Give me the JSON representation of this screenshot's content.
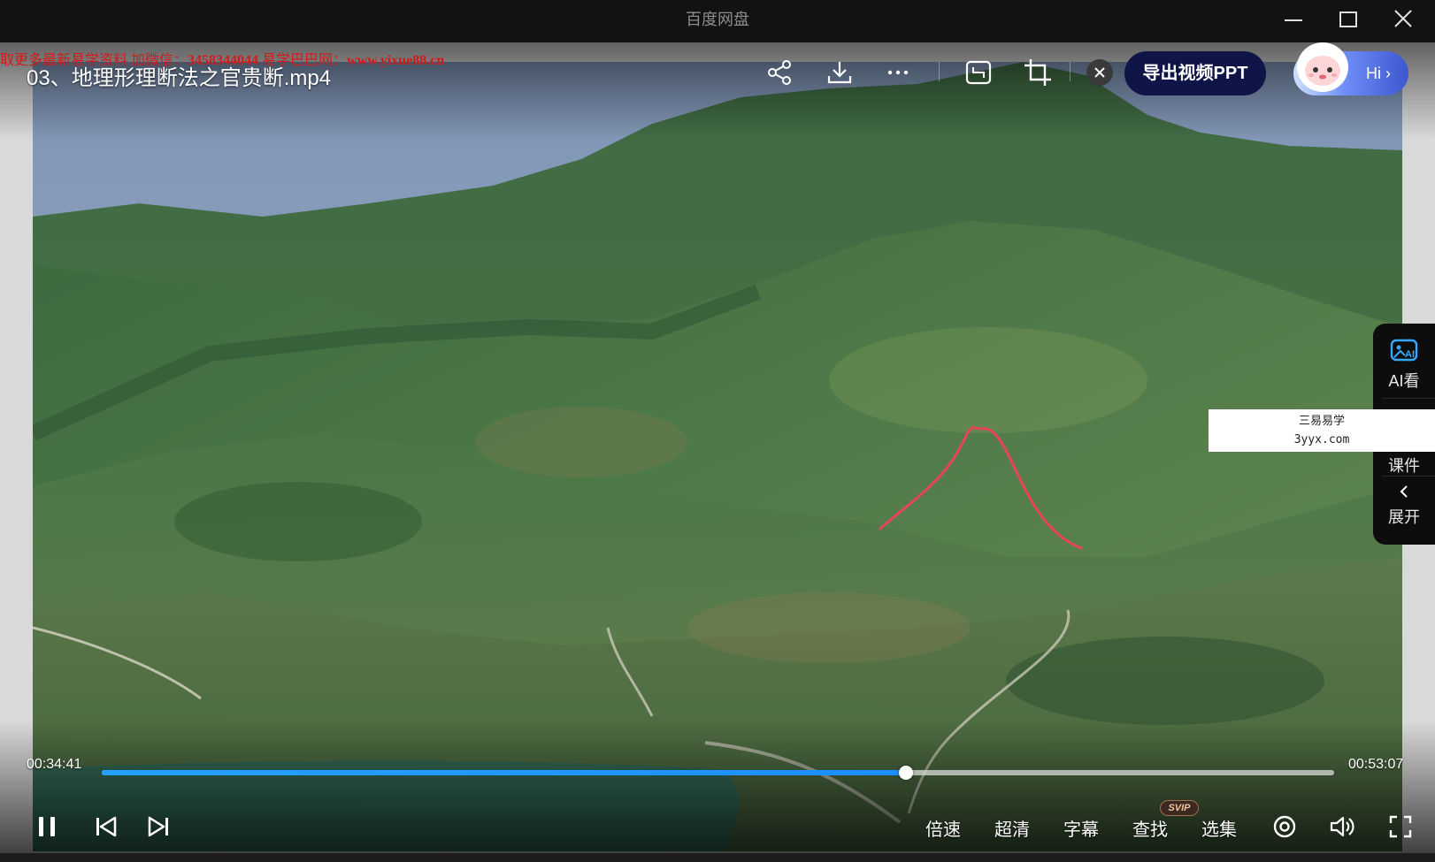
{
  "window": {
    "title": "百度网盘"
  },
  "video": {
    "file_title": "03、地理形理断法之官贵断.mp4",
    "watermark": {
      "prefix": "取更多最新易学资料 加微信：",
      "wechat": "3458344044",
      "middle": " 易学巴巴网：",
      "site": "www.yixue88.cn"
    },
    "export_ppt_label": "导出视频PPT",
    "hi_label": "Hi",
    "course_watermark": {
      "line1": "三易易学",
      "line2": "3yyx.com"
    }
  },
  "side_panel": {
    "ai_label": "AI看",
    "course_label": "课件",
    "expand_label": "展开"
  },
  "playback": {
    "current_time": "00:34:41",
    "total_time": "00:53:07",
    "progress": 0.6527
  },
  "controls": {
    "speed_label": "倍速",
    "quality_label": "超清",
    "subtitle_label": "字幕",
    "search_label": "查找",
    "svip_badge": "SVIP",
    "episodes_label": "选集"
  },
  "colors": {
    "accent": "#1a8fff",
    "ppt_button": "#0f1547",
    "watermark_red": "#d21a1a",
    "annotation_stroke": "#e8445a"
  }
}
